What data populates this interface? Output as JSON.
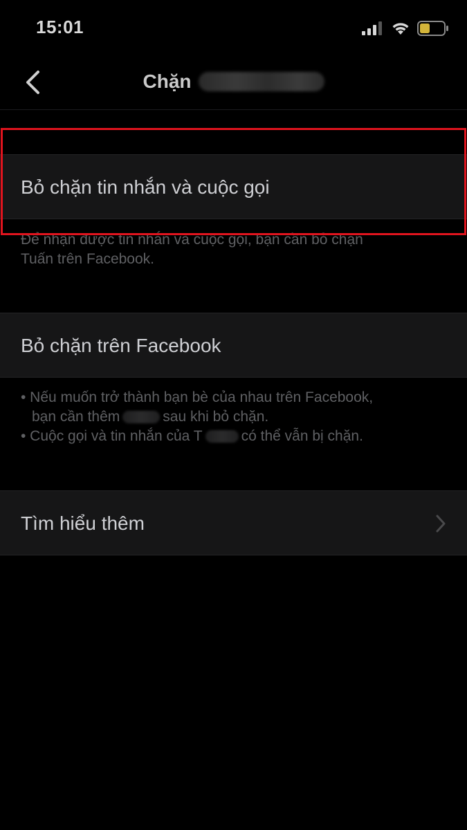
{
  "status_bar": {
    "time": "15:01",
    "icons": [
      "signal-icon",
      "wifi-icon",
      "battery-icon"
    ],
    "battery_color": "#d4b53a"
  },
  "header": {
    "title_prefix": "Chặn",
    "back_icon": "chevron-left-icon"
  },
  "sections": [
    {
      "label": "Bỏ chặn tin nhắn và cuộc gọi",
      "description": [
        "Để nhận được tin nhắn và cuộc gọi, bạn cần bỏ chặn",
        "Tuấn trên Facebook."
      ]
    },
    {
      "label": "Bỏ chặn trên Facebook",
      "bullets": {
        "b1_line1": "• Nếu muốn trở thành bạn bè của nhau trên Facebook,",
        "b1_line2_a": "bạn cần thêm",
        "b1_line2_b": "sau khi bỏ chặn.",
        "b2_a": "• Cuộc gọi và tin nhắn của T",
        "b2_b": "có thể vẫn bị chặn."
      }
    },
    {
      "label": "Tìm hiểu thêm",
      "icon": "chevron-right-icon"
    }
  ],
  "colors": {
    "background": "#000000",
    "row_background": "#161617",
    "highlight": "#e0141e"
  }
}
